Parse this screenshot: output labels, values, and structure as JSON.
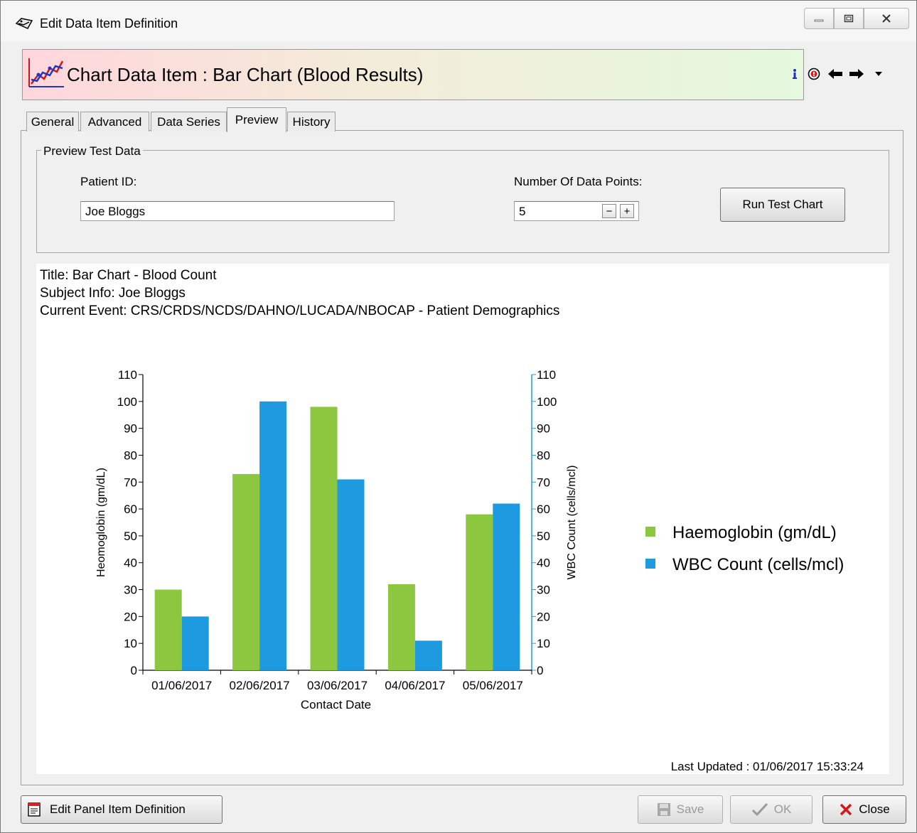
{
  "window": {
    "title": "Edit Data Item Definition"
  },
  "header": {
    "title": "Chart Data Item : Bar Chart (Blood Results)"
  },
  "tabs": [
    {
      "label": "General"
    },
    {
      "label": "Advanced"
    },
    {
      "label": "Data Series"
    },
    {
      "label": "Preview",
      "active": true
    },
    {
      "label": "History"
    }
  ],
  "preview": {
    "group_title": "Preview Test Data",
    "patient_id_label": "Patient ID:",
    "patient_id_value": "Joe Bloggs",
    "data_points_label": "Number Of Data Points:",
    "data_points_value": "5",
    "run_button": "Run Test Chart"
  },
  "chart_info": {
    "title_line": "Title: Bar Chart - Blood Count",
    "subject_line": "Subject Info: Joe Bloggs",
    "event_line": "Current  Event:  CRS/CRDS/NCDS/DAHNO/LUCADA/NBOCAP  -  Patient  Demographics",
    "last_updated": "Last Updated : 01/06/2017 15:33:24"
  },
  "chart_data": {
    "type": "bar",
    "categories": [
      "01/06/2017",
      "02/06/2017",
      "03/06/2017",
      "04/06/2017",
      "05/06/2017"
    ],
    "series": [
      {
        "name": "Haemoglobin (gm/dL)",
        "values": [
          30,
          73,
          98,
          32,
          58
        ],
        "color": "#8dc63f",
        "axis": "left"
      },
      {
        "name": "WBC Count (cells/mcl)",
        "values": [
          20,
          100,
          71,
          11,
          62
        ],
        "color": "#1e9be0",
        "axis": "right"
      }
    ],
    "xlabel": "Contact Date",
    "ylabel": "Heomoglobin (gm/dL)",
    "y2label": "WBC Count (cells/mcl)",
    "ylim": [
      0,
      110
    ],
    "y2lim": [
      0,
      110
    ],
    "yticks": [
      0,
      10,
      20,
      30,
      40,
      50,
      60,
      70,
      80,
      90,
      100,
      110
    ],
    "legend_position": "right",
    "grid": false
  },
  "footer": {
    "edit_panel_button": "Edit Panel Item Definition",
    "save_button": "Save",
    "ok_button": "OK",
    "close_button": "Close"
  },
  "colors": {
    "haemoglobin": "#8dc63f",
    "wbc": "#1e9be0",
    "axis_right": "#1e9be0"
  },
  "icons": [
    "edit-definition-icon",
    "chart-item-icon",
    "info-icon",
    "help-icon",
    "back-arrow-icon",
    "forward-arrow-icon",
    "dropdown-icon",
    "edit-panel-icon",
    "save-icon",
    "check-icon",
    "close-x-icon"
  ]
}
